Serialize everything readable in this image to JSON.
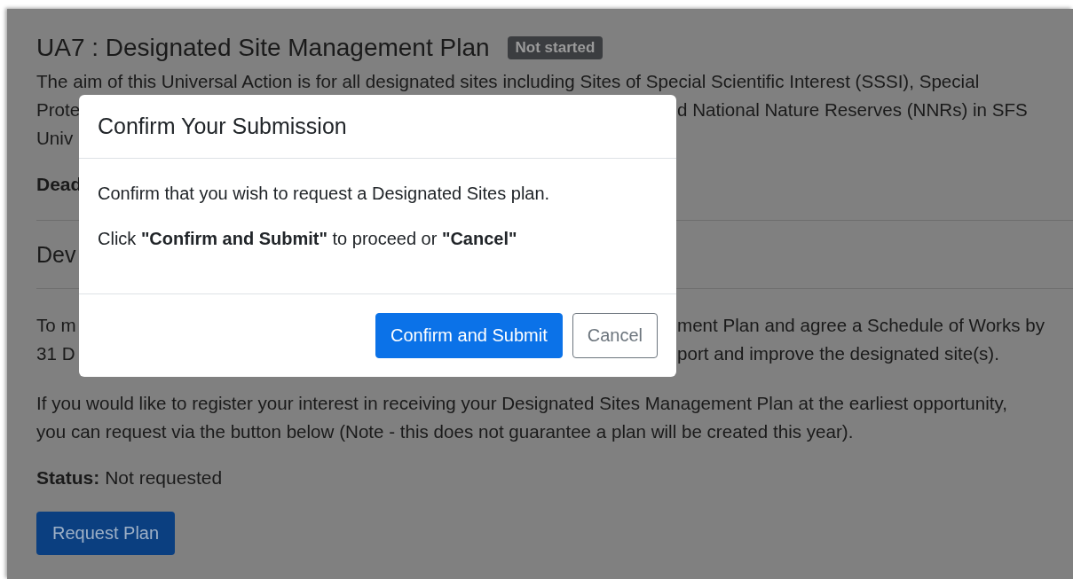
{
  "page": {
    "title": "UA7 : Designated Site Management Plan",
    "badge": "Not started",
    "intro_lines": [
      {
        "left": "The aim of this Universal Action is for all designated sites including Sites of Special Scientific Interest (SSSI), Special"
      },
      {
        "left": "Prote",
        "right": "d National Nature Reserves (NNRs) in SFS"
      },
      {
        "left": "Univ"
      }
    ],
    "deadline_label": "Dead",
    "section_heading": "Dev",
    "section_lines": [
      {
        "left": "To m",
        "right": "ment Plan and agree a Schedule of Works by"
      },
      {
        "left": "31 D",
        "right": "port and improve the designated site(s)."
      }
    ],
    "interest_lines": [
      "If you would like to register your interest in receiving your Designated Sites Management Plan at the earliest opportunity,",
      "you can request via the button below (Note - this does not guarantee a plan will be created this year)."
    ],
    "status_label": "Status:",
    "status_value": "Not requested",
    "request_button": "Request Plan"
  },
  "modal": {
    "title": "Confirm Your Submission",
    "message": "Confirm that you wish to request a Designated Sites plan.",
    "instruction": "Click **\"Confirm and Submit\"** to proceed or **\"Cancel\"**",
    "buttons": [
      {
        "label": "Confirm and Submit",
        "kind": "primary"
      },
      {
        "label": "Cancel",
        "kind": "secondary"
      }
    ]
  }
}
